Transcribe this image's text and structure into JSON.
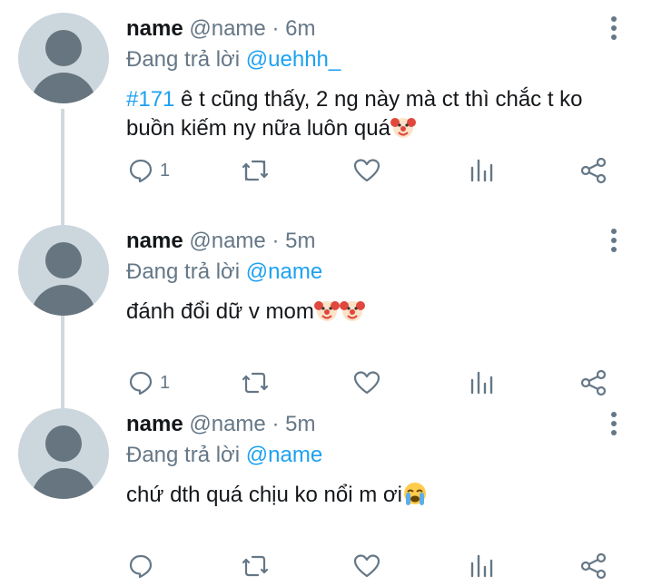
{
  "tweets": [
    {
      "name": "name",
      "handle": "@name",
      "separator": "·",
      "time": "6m",
      "reply_prefix": "Đang trả lời ",
      "reply_to": "@uehhh_",
      "hashtag": "#171",
      "text": " ê t cũng thấy, 2 ng này mà ct thì chắc t ko buồn kiếm ny nữa luôn quá",
      "emojis": [
        "clown-face"
      ],
      "reply_count": "1"
    },
    {
      "name": "name",
      "handle": "@name",
      "separator": "·",
      "time": "5m",
      "reply_prefix": "Đang trả lời ",
      "reply_to": "@name",
      "text": "đánh đổi dữ v mom",
      "emojis": [
        "clown-face",
        "clown-face"
      ],
      "reply_count": "1"
    },
    {
      "name": "name",
      "handle": "@name",
      "separator": "·",
      "time": "5m",
      "reply_prefix": "Đang trả lời ",
      "reply_to": "@name",
      "text": "chứ dth quá chịu ko nổi m ơi",
      "emojis": [
        "loudly-crying-face"
      ],
      "reply_count": ""
    }
  ],
  "icons": {
    "more": "more-vertical-icon",
    "reply": "reply-icon",
    "retweet": "retweet-icon",
    "like": "heart-icon",
    "analytics": "analytics-icon",
    "share": "share-icon"
  },
  "colors": {
    "link": "#1da1f2",
    "secondary": "#657786",
    "text": "#14171a",
    "avatar_bg": "#ccd6dd",
    "thread_line": "#cfd9de"
  }
}
